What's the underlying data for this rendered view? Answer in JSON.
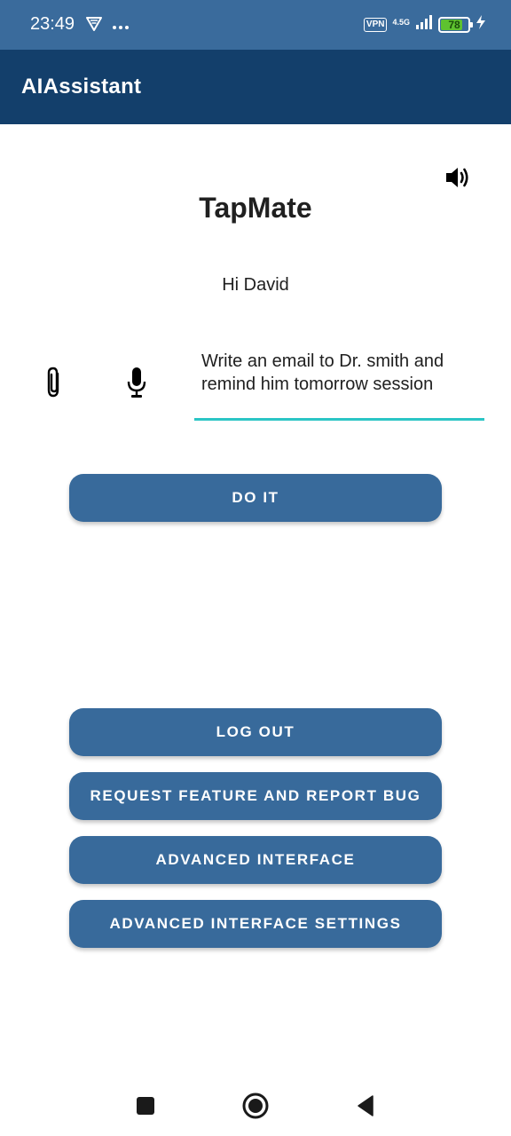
{
  "status_bar": {
    "time": "23:49",
    "left_icons": [
      "vpn-shield-icon",
      "more-dots-icon"
    ],
    "vpn_label": "VPN",
    "network_type": "4.5G",
    "battery_level": "78",
    "charging": true
  },
  "app_bar": {
    "title": "AIAssistant"
  },
  "main": {
    "title": "TapMate",
    "greeting": "Hi David",
    "prompt_value": "Write an email to Dr. smith and\nremind him tomorrow session",
    "icons": [
      "volume-icon",
      "paperclip-icon",
      "microphone-icon"
    ]
  },
  "buttons": {
    "do_it": "DO IT",
    "log_out": "LOG OUT",
    "request_feature": "REQUEST FEATURE AND REPORT BUG",
    "advanced_interface": "ADVANCED INTERFACE",
    "advanced_interface_settings": "ADVANCED INTERFACE SETTINGS"
  },
  "nav_bar": {
    "icons": [
      "recents-square-icon",
      "home-circle-icon",
      "back-triangle-icon"
    ]
  },
  "colors": {
    "status_bar": "#3a6b9c",
    "app_bar": "#133f6b",
    "button": "#386a9b",
    "input_underline": "#2bc5c5",
    "battery_fill": "#5ec22f"
  }
}
